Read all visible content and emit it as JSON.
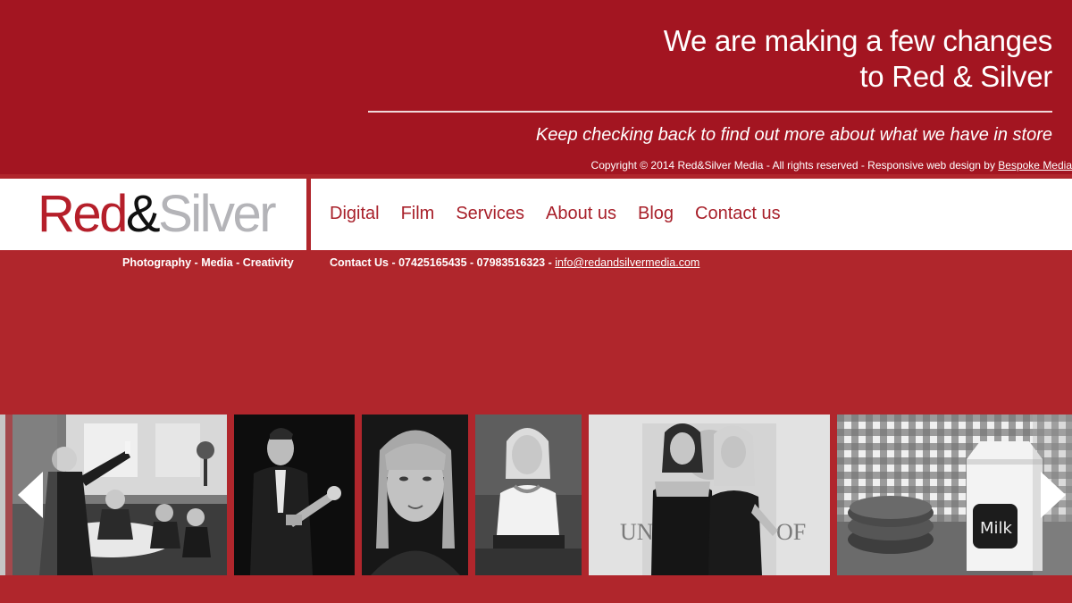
{
  "banner": {
    "headline_line1": "We are making a few changes",
    "headline_line2": "to Red & Silver",
    "tagline": "Keep checking back to find out more about what we have in store",
    "copyright_text": "Copyright © 2014 Red&Silver Media - All rights reserved - Responsive web design by ",
    "copyright_link": "Bespoke Media"
  },
  "logo": {
    "part1": "Red",
    "part2": "&",
    "part3": "Silver"
  },
  "nav": {
    "items": [
      {
        "label": "Digital"
      },
      {
        "label": "Film"
      },
      {
        "label": "Services"
      },
      {
        "label": "About us"
      },
      {
        "label": "Blog"
      },
      {
        "label": "Contact us"
      }
    ]
  },
  "subheader": {
    "tagline": "Photography - Media - Creativity",
    "contact_text": "Contact Us - 07425165435 - 07983516323 - ",
    "email": "info@redandsilvermedia.com"
  },
  "gallery": {
    "photos": [
      {
        "name": "banquet-toast-photo",
        "label": "Banquet toast"
      },
      {
        "name": "trumpet-player-photo",
        "label": "Trumpet player"
      },
      {
        "name": "woman-portrait-photo",
        "label": "Woman portrait"
      },
      {
        "name": "seated-woman-photo",
        "label": "Seated woman"
      },
      {
        "name": "two-women-photo",
        "label": "Two women"
      },
      {
        "name": "cookies-milk-photo",
        "label": "Cookies and milk"
      }
    ]
  },
  "colors": {
    "banner": "#a31521",
    "page": "#b0262c",
    "nav_text": "#a8202a",
    "logo_red": "#b51f2a",
    "logo_silver": "#b4b4b8"
  }
}
